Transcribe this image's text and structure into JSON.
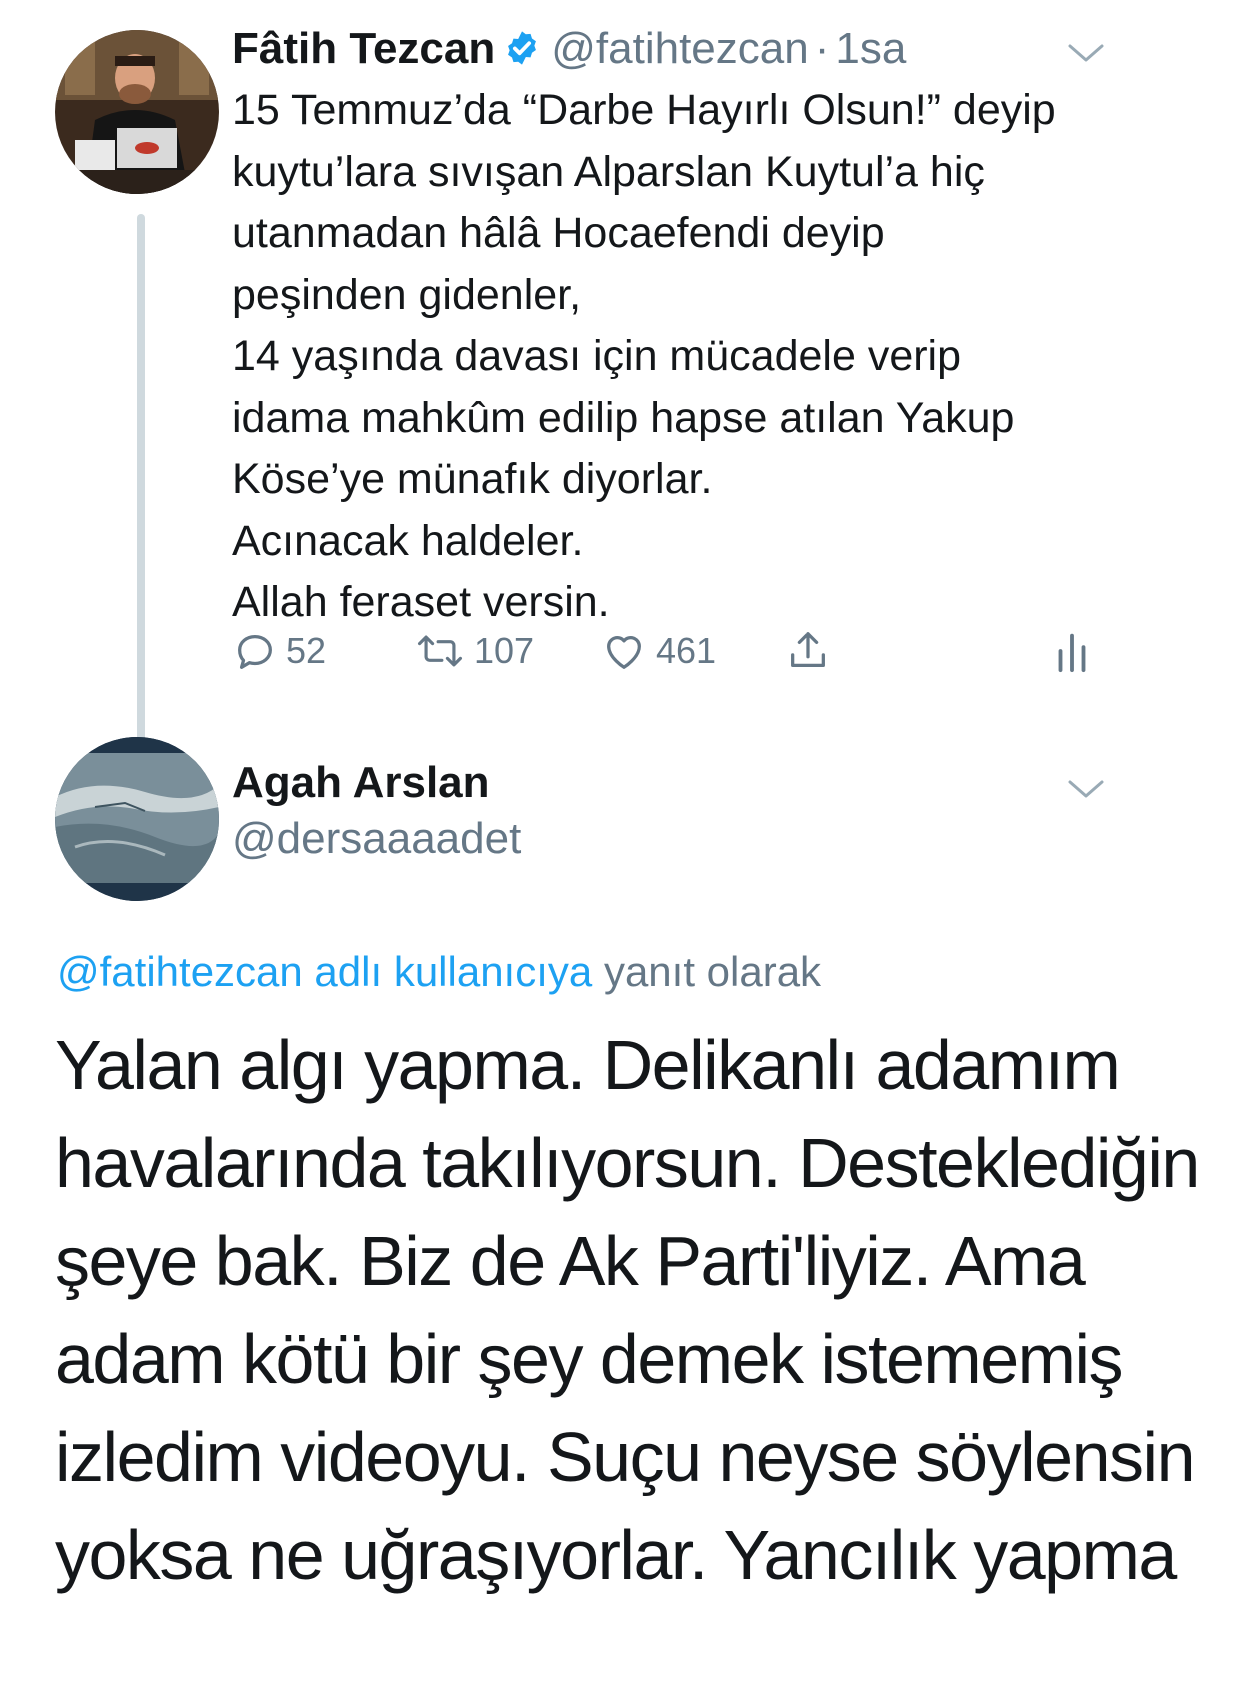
{
  "tweet": {
    "author_name": "Fâtih Tezcan",
    "author_handle": "@fatihtezcan",
    "separator": "·",
    "time": "1sa",
    "lines": [
      "15 Temmuz’da “Darbe Hayırlı Olsun!” deyip",
      "kuytu’lara sıvışan Alparslan Kuytul’a hiç",
      "utanmadan hâlâ Hocaefendi deyip",
      "peşinden gidenler,",
      "14 yaşında davası için mücadele verip",
      "idama mahkûm edilip hapse atılan Yakup",
      "Köse’ye münafık diyorlar.",
      "Acınacak haldeler.",
      "Allah feraset versin."
    ],
    "replies": "52",
    "retweets": "107",
    "likes": "461",
    "icons": [
      "verified-badge-icon",
      "chevron-down-icon",
      "reply-icon",
      "retweet-icon",
      "like-icon",
      "share-icon",
      "analytics-icon"
    ],
    "colors": {
      "verified": "#1da1f2",
      "muted": "#657786",
      "thread_line": "#cfd9de"
    }
  },
  "reply": {
    "author_name": "Agah Arslan",
    "author_handle": "@dersaaaadet",
    "replying_to_link": "@fatihtezcan adlı kullanıcıya",
    "replying_to_suffix": "yanıt olarak",
    "lines": [
      "Yalan algı yapma. Delikanlı adamım",
      "havalarında takılıyorsun. Desteklediğin",
      "şeye bak. Biz de Ak Parti'liyiz. Ama",
      "adam kötü bir şey demek istememiş",
      "izledim videoyu. Suçu neyse söylensin",
      "yoksa ne uğraşıyorlar. Yancılık yapma"
    ],
    "colors": {
      "link": "#1da1f2"
    }
  }
}
